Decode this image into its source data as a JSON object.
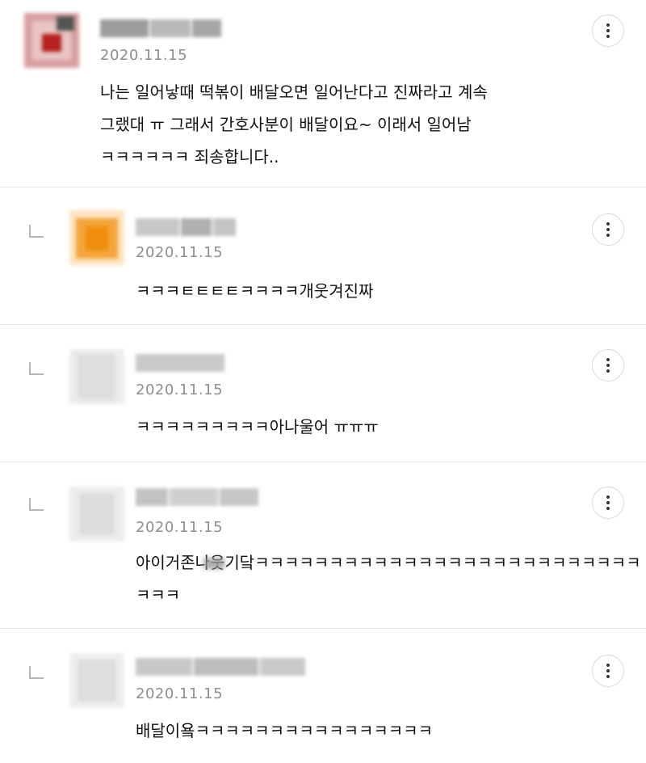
{
  "comments": [
    {
      "date": "2020.11.15",
      "text": "나는 일어낳때 떡볶이 배달오면 일어난다고 진짜라고 계속\n그랬대 ㅠ 그래서 간호사분이 배달이요~ 이래서 일어남\nㅋㅋㅋㅋㅋㅋ 죄송합니다..",
      "avatar_color": "#c94040",
      "more_icon": "more-vertical-icon"
    },
    {
      "date": "2020.11.15",
      "text": "ㅋㅋㅋㅌㅌㅌㅌㅋㅋㅋㅋ개웃겨진짜",
      "avatar_color": "#f29a1a",
      "reply_icon": "reply-arrow-icon",
      "more_icon": "more-vertical-icon"
    },
    {
      "date": "2020.11.15",
      "text": "ㅋㅋㅋㅋㅋㅋㅋㅋㅋ아나울어 ㅠㅠㅠ",
      "avatar_color": "#e0e0e0",
      "reply_icon": "reply-arrow-icon",
      "more_icon": "more-vertical-icon"
    },
    {
      "date": "2020.11.15",
      "text": "아이거존나웃기닼ㅋㅋㅋㅋㅋㅋㅋㅋㅋㅋㅋㅋㅋㅋㅋㅋㅋㅋㅋㅋㅋㅋㅋㅋㅋㅋ\nㅋㅋㅋ",
      "avatar_color": "#e2e2e2",
      "reply_icon": "reply-arrow-icon",
      "more_icon": "more-vertical-icon"
    },
    {
      "date": "2020.11.15",
      "text": "배달이욬ㅋㅋㅋㅋㅋㅋㅋㅋㅋㅋㅋㅋㅋㅋㅋㅋ",
      "avatar_color": "#e3e3e3",
      "reply_icon": "reply-arrow-icon",
      "more_icon": "more-vertical-icon"
    }
  ]
}
